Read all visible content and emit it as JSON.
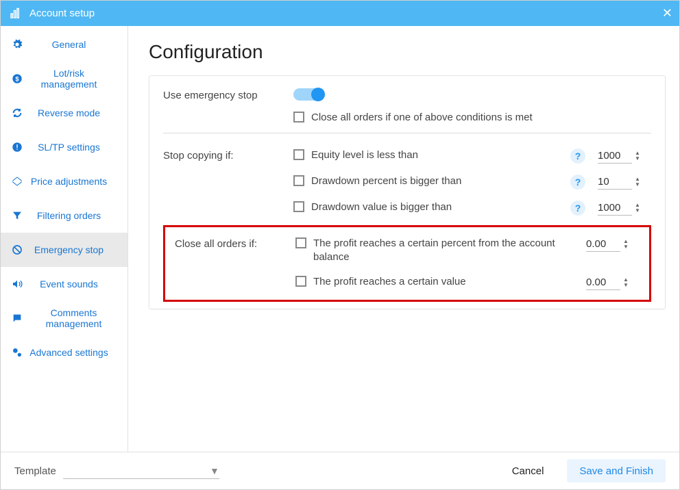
{
  "window": {
    "title": "Account setup"
  },
  "sidebar": {
    "items": [
      {
        "label": "General"
      },
      {
        "label": "Lot/risk management"
      },
      {
        "label": "Reverse mode"
      },
      {
        "label": "SL/TP settings"
      },
      {
        "label": "Price adjustments"
      },
      {
        "label": "Filtering orders"
      },
      {
        "label": "Emergency stop"
      },
      {
        "label": "Event sounds"
      },
      {
        "label": "Comments management"
      },
      {
        "label": "Advanced settings"
      }
    ]
  },
  "main": {
    "heading": "Configuration",
    "use_emergency_label": "Use emergency stop",
    "close_all_conditions_label": "Close all orders if one of above conditions is met",
    "stop_copying_label": "Stop copying if:",
    "cond_equity_label": "Equity level is less than",
    "cond_equity_value": "1000",
    "cond_dd_pct_label": "Drawdown percent is bigger than",
    "cond_dd_pct_value": "10",
    "cond_dd_val_label": "Drawdown value is bigger than",
    "cond_dd_val_value": "1000",
    "close_all_if_label": "Close all orders if:",
    "profit_pct_label": "The profit reaches a certain percent from the account balance",
    "profit_pct_value": "0.00",
    "profit_val_label": "The profit reaches a certain value",
    "profit_val_value": "0.00"
  },
  "footer": {
    "template_label": "Template",
    "cancel": "Cancel",
    "save": "Save and Finish"
  }
}
